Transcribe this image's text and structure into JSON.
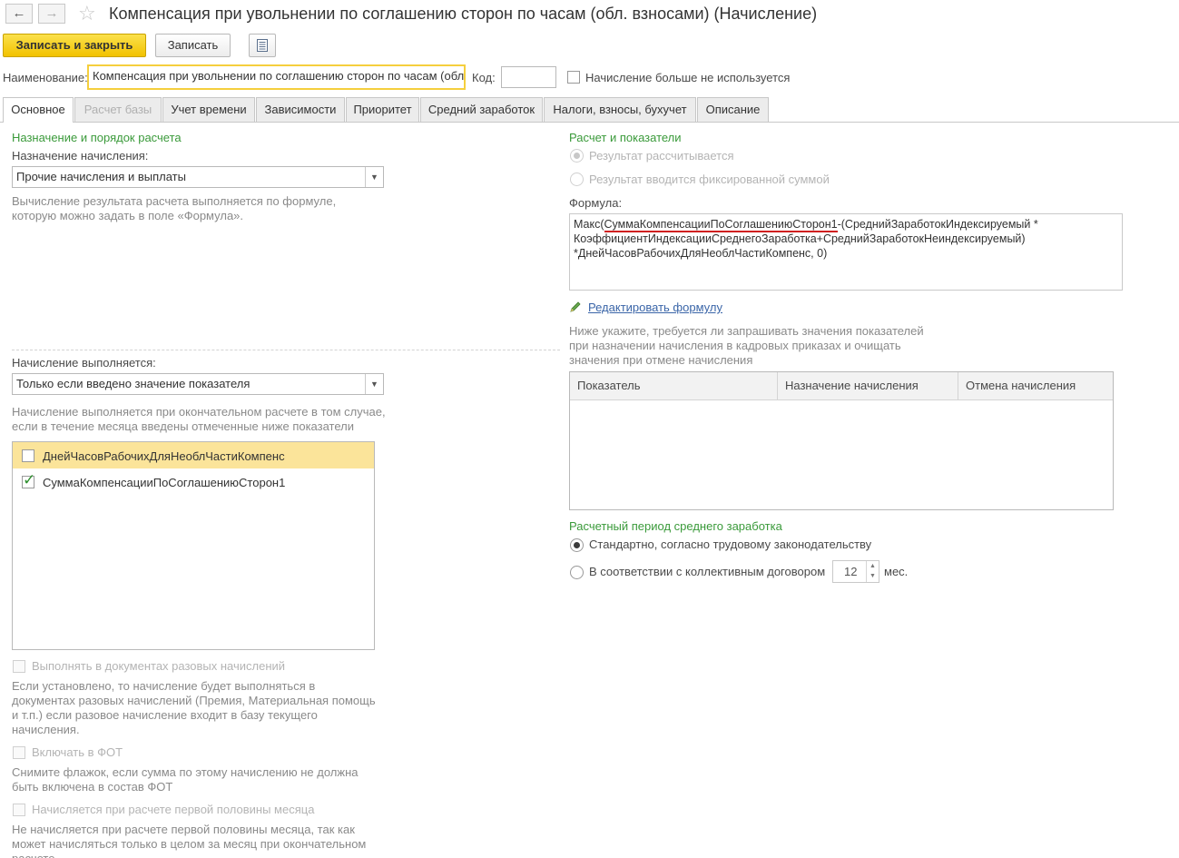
{
  "window": {
    "title": "Компенсация при увольнении по соглашению сторон по часам (обл. взносами) (Начисление)"
  },
  "toolbar": {
    "save_close": "Записать и закрыть",
    "save": "Записать"
  },
  "header": {
    "name_label": "Наименование:",
    "name_value": "Компенсация при увольнении по соглашению сторон по часам (обл. взносами)",
    "code_label": "Код:",
    "code_value": "",
    "not_used_label": "Начисление больше не используется",
    "not_used_checked": false
  },
  "tabs": [
    {
      "label": "Основное",
      "active": true,
      "enabled": true
    },
    {
      "label": "Расчет базы",
      "active": false,
      "enabled": false
    },
    {
      "label": "Учет времени",
      "active": false,
      "enabled": true
    },
    {
      "label": "Зависимости",
      "active": false,
      "enabled": true
    },
    {
      "label": "Приоритет",
      "active": false,
      "enabled": true
    },
    {
      "label": "Средний заработок",
      "active": false,
      "enabled": true
    },
    {
      "label": "Налоги, взносы, бухучет",
      "active": false,
      "enabled": true
    },
    {
      "label": "Описание",
      "active": false,
      "enabled": true
    }
  ],
  "left": {
    "section_title": "Назначение и порядок расчета",
    "purpose_label": "Назначение начисления:",
    "purpose_value": "Прочие начисления и выплаты",
    "purpose_hint": "Вычисление результата расчета выполняется по формуле, которую можно задать в поле «Формула».",
    "execution_label": "Начисление выполняется:",
    "execution_value": "Только если введено значение показателя",
    "execution_hint": "Начисление выполняется при окончательном расчете в том случае, если в течение месяца введены отмеченные ниже показатели",
    "indicators": [
      {
        "label": "ДнейЧасовРабочихДляНеоблЧастиКомпенс",
        "checked": false,
        "selected": true
      },
      {
        "label": "СуммаКомпенсацииПоСоглашениюСторон1",
        "checked": true,
        "selected": false
      }
    ],
    "one_time_label": "Выполнять в документах разовых начислений",
    "one_time_hint": "Если установлено, то начисление будет выполняться в документах разовых начислений (Премия, Материальная помощь и т.п.) если разовое начисление входит в базу текущего начисления.",
    "fot_label": "Включать в ФОТ",
    "fot_hint": "Снимите флажок, если сумма по этому начислению не должна быть включена в состав ФОТ",
    "first_half_label": "Начисляется при расчете первой половины месяца",
    "first_half_hint": "Не начисляется при расчете первой половины месяца, так как может начисляться только в целом за месяц при окончательном расчете."
  },
  "right": {
    "section_title": "Расчет и показатели",
    "radio_calculated": "Результат рассчитывается",
    "radio_fixed": "Результат вводится фиксированной суммой",
    "formula_label": "Формула:",
    "formula_line1_prefix": "Макс(",
    "formula_line1_underlined": "СуммаКомпенсацииПоСоглашениюСторон1",
    "formula_line1_suffix": "-(СреднийЗаработокИндексируемый *",
    "formula_line2": "КоэффициентИндексацииСреднегоЗаработка+СреднийЗаработокНеиндексируемый)",
    "formula_line3": "*ДнейЧасовРабочихДляНеоблЧастиКомпенс, 0)",
    "edit_formula_link": "Редактировать формулу",
    "request_hint": "Ниже укажите, требуется ли запрашивать значения показателей при назначении начисления в кадровых приказах и очищать значения при отмене начисления",
    "grid_columns": [
      "Показатель",
      "Назначение начисления",
      "Отмена начисления"
    ],
    "avg_period_title": "Расчетный период среднего заработка",
    "avg_standard": "Стандартно, согласно трудовому законодательству",
    "avg_collective": "В соответствии с коллективным договором",
    "avg_months_value": "12",
    "avg_months_unit": "мес."
  },
  "colors": {
    "accent_yellow": "#f5cf3d",
    "section_green": "#3a9a3a",
    "link_blue": "#3a65a8",
    "formula_underline": "#d02020"
  }
}
